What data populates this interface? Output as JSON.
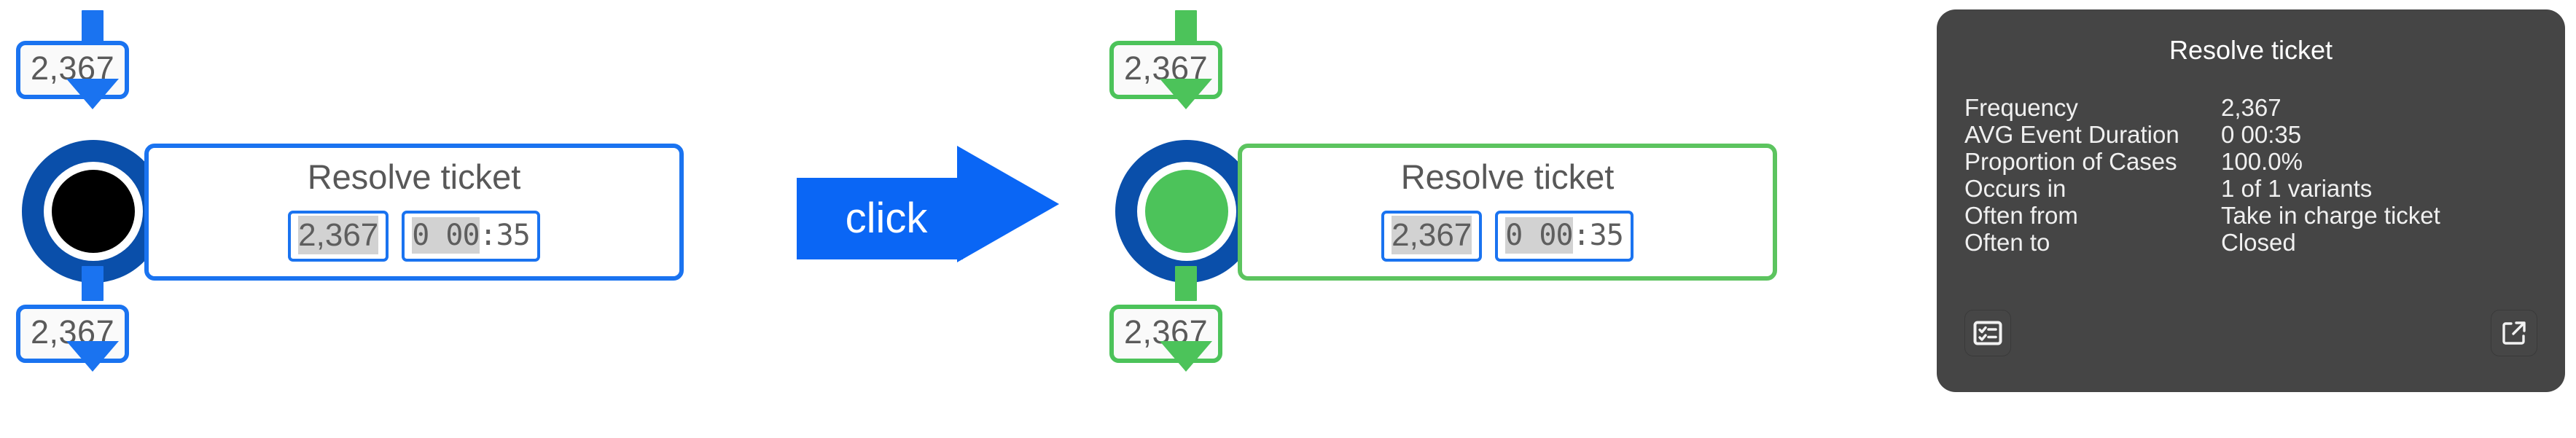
{
  "left_panel": {
    "state_label": "unselected",
    "accent_color": "#1a73f0",
    "ring_color": "#0a4faa",
    "core_color": "#000000",
    "incoming_count": "2,367",
    "outgoing_count": "2,367",
    "activity": {
      "name": "Resolve ticket",
      "frequency_chip": "2,367",
      "duration_chip_prefix": "0 00",
      "duration_chip_suffix": ":35",
      "duration_chip": "0 00:35"
    }
  },
  "click_arrow": {
    "label": "click",
    "color": "#0a66f5",
    "icon": "right-arrow-icon"
  },
  "right_panel": {
    "state_label": "selected",
    "accent_color": "#4cc35a",
    "ring_color": "#0a4faa",
    "core_color": "#4cc35a",
    "incoming_count": "2,367",
    "outgoing_count": "2,367",
    "activity": {
      "name": "Resolve ticket",
      "frequency_chip": "2,367",
      "duration_chip_prefix": "0 00",
      "duration_chip_suffix": ":35",
      "duration_chip": "0 00:35"
    }
  },
  "tooltip": {
    "background_color": "#454545",
    "title": "Resolve ticket",
    "rows": [
      {
        "label": "Frequency",
        "value": "2,367"
      },
      {
        "label": "AVG Event Duration",
        "value": "0 00:35"
      },
      {
        "label": "Proportion of Cases",
        "value": "100.0%"
      },
      {
        "label": "Occurs in",
        "value": "1 of 1 variants"
      },
      {
        "label": "Often from",
        "value": "Take in charge ticket"
      },
      {
        "label": "Often to",
        "value": "Closed"
      }
    ],
    "actions": {
      "details_icon": "checklist-icon",
      "open_external_icon": "external-link-icon"
    }
  }
}
